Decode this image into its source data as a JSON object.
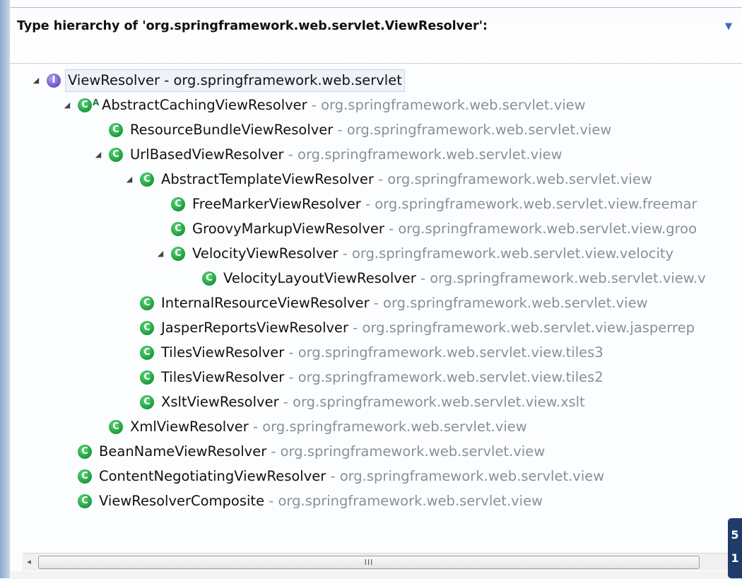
{
  "header": {
    "title": "Type hierarchy of 'org.springframework.web.servlet.ViewResolver':",
    "menu_icon": "chevron-down-icon"
  },
  "tree": [
    {
      "depth": 0,
      "expanded": true,
      "kind": "interface",
      "name": "ViewResolver",
      "pkg": "org.springframework.web.servlet",
      "root": true
    },
    {
      "depth": 1,
      "expanded": true,
      "kind": "class",
      "abstract": true,
      "name": "AbstractCachingViewResolver",
      "pkg": "org.springframework.web.servlet.view"
    },
    {
      "depth": 2,
      "kind": "class",
      "name": "ResourceBundleViewResolver",
      "pkg": "org.springframework.web.servlet.view"
    },
    {
      "depth": 2,
      "expanded": true,
      "kind": "class",
      "name": "UrlBasedViewResolver",
      "pkg": "org.springframework.web.servlet.view"
    },
    {
      "depth": 3,
      "expanded": true,
      "kind": "class",
      "name": "AbstractTemplateViewResolver",
      "pkg": "org.springframework.web.servlet.view"
    },
    {
      "depth": 4,
      "kind": "class",
      "name": "FreeMarkerViewResolver",
      "pkg": "org.springframework.web.servlet.view.freemar"
    },
    {
      "depth": 4,
      "kind": "class",
      "name": "GroovyMarkupViewResolver",
      "pkg": "org.springframework.web.servlet.view.groo"
    },
    {
      "depth": 4,
      "expanded": true,
      "kind": "class",
      "name": "VelocityViewResolver",
      "pkg": "org.springframework.web.servlet.view.velocity"
    },
    {
      "depth": 5,
      "kind": "class",
      "name": "VelocityLayoutViewResolver",
      "pkg": "org.springframework.web.servlet.view.v"
    },
    {
      "depth": 3,
      "kind": "class",
      "name": "InternalResourceViewResolver",
      "pkg": "org.springframework.web.servlet.view"
    },
    {
      "depth": 3,
      "kind": "class",
      "name": "JasperReportsViewResolver",
      "pkg": "org.springframework.web.servlet.view.jasperrep"
    },
    {
      "depth": 3,
      "kind": "class",
      "name": "TilesViewResolver",
      "pkg": "org.springframework.web.servlet.view.tiles3"
    },
    {
      "depth": 3,
      "kind": "class",
      "name": "TilesViewResolver",
      "pkg": "org.springframework.web.servlet.view.tiles2"
    },
    {
      "depth": 3,
      "kind": "class",
      "name": "XsltViewResolver",
      "pkg": "org.springframework.web.servlet.view.xslt"
    },
    {
      "depth": 2,
      "kind": "class",
      "name": "XmlViewResolver",
      "pkg": "org.springframework.web.servlet.view"
    },
    {
      "depth": 1,
      "kind": "class",
      "name": "BeanNameViewResolver",
      "pkg": "org.springframework.web.servlet.view"
    },
    {
      "depth": 1,
      "kind": "class",
      "name": "ContentNegotiatingViewResolver",
      "pkg": "org.springframework.web.servlet.view"
    },
    {
      "depth": 1,
      "kind": "class",
      "name": "ViewResolverComposite",
      "pkg": "org.springframework.web.servlet.view"
    }
  ],
  "separator": " - ",
  "icons": {
    "class": "class-icon",
    "interface": "interface-icon",
    "expanded": "expanded-twisty-icon"
  },
  "icon_glyphs": {
    "class": "C",
    "interface": "I",
    "abstract_mark": "A"
  },
  "scrollbar": {
    "left_arrow": "◂",
    "grip": "III"
  },
  "floater": {
    "top": "5",
    "bottom": "1"
  },
  "colors": {
    "class_icon": "#1a9a3c",
    "interface_icon": "#6b52c8",
    "package_text": "#8a8f96",
    "accent": "#3a6bb3"
  }
}
